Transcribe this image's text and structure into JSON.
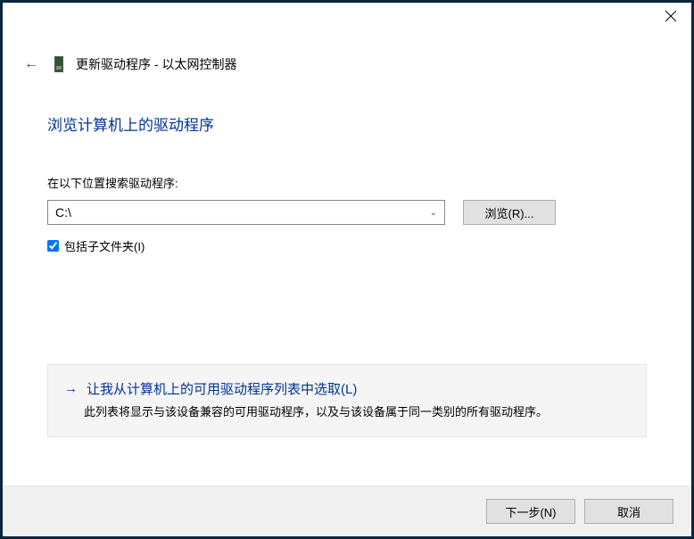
{
  "header": {
    "title": "更新驱动程序 - 以太网控制器"
  },
  "main": {
    "heading": "浏览计算机上的驱动程序",
    "search_label": "在以下位置搜索驱动程序:",
    "path_value": "C:\\",
    "browse_button": "浏览(R)...",
    "include_subfolders_label": "包括子文件夹(I)",
    "option_title": "让我从计算机上的可用驱动程序列表中选取(L)",
    "option_desc": "此列表将显示与该设备兼容的可用驱动程序，以及与该设备属于同一类别的所有驱动程序。"
  },
  "footer": {
    "next": "下一步(N)",
    "cancel": "取消"
  }
}
